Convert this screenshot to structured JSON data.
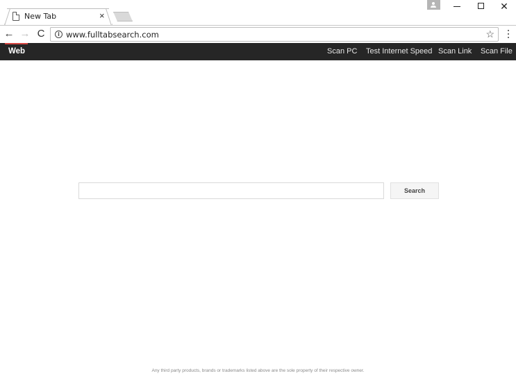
{
  "browser": {
    "tab_title": "New Tab",
    "tab_close_glyph": "×",
    "url": "www.fulltabsearch.com",
    "icons": [
      "page-icon",
      "close-icon",
      "profile-icon",
      "minimize-icon",
      "maximize-icon",
      "window-close-icon",
      "back-icon",
      "forward-icon",
      "reload-icon",
      "info-icon",
      "star-icon",
      "menu-icon"
    ],
    "back_glyph": "←",
    "forward_glyph": "→",
    "reload_glyph": "C",
    "info_glyph": "i",
    "star_glyph": "☆",
    "window_close_glyph": "✕"
  },
  "site_nav": {
    "brand": "Web",
    "links": [
      "Scan PC",
      "Test Internet Speed",
      "Scan Link",
      "Scan File"
    ],
    "accent_color": "#d64541",
    "background_color": "#262626"
  },
  "search": {
    "value": "",
    "button_label": "Search"
  },
  "footer": {
    "text": "Any third party products, brands or trademarks listed above are the sole property of their respective owner."
  }
}
